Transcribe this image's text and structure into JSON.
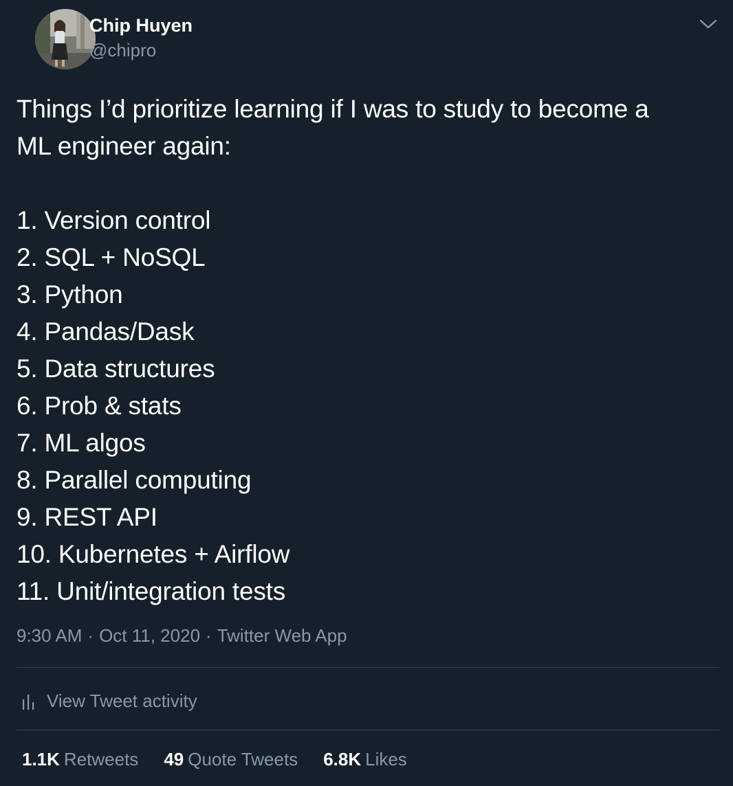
{
  "author": {
    "name": "Chip Huyen",
    "handle": "@chipro"
  },
  "tweet": {
    "intro_lines": [
      "Things I’d prioritize learning if I was to study to become a",
      "ML engineer again:"
    ],
    "list_items": [
      "1. Version control",
      "2. SQL + NoSQL",
      "3. Python",
      "4. Pandas/Dask",
      "5. Data structures",
      "6. Prob & stats",
      "7. ML algos",
      "8. Parallel computing",
      "9. REST API",
      "10. Kubernetes + Airflow",
      "11. Unit/integration tests"
    ]
  },
  "meta": {
    "time": "9:30 AM",
    "date": "Oct 11, 2020",
    "source": "Twitter Web App",
    "separator": "·"
  },
  "activity": {
    "label": "View Tweet activity",
    "icon": "bar-chart-icon"
  },
  "stats": {
    "retweets": {
      "count": "1.1K",
      "label": "Retweets"
    },
    "quote_tweets": {
      "count": "49",
      "label": "Quote Tweets"
    },
    "likes": {
      "count": "6.8K",
      "label": "Likes"
    }
  },
  "colors": {
    "background": "#15202b",
    "text": "#ffffff",
    "secondary_text": "#8899a6",
    "divider": "#38444d"
  }
}
